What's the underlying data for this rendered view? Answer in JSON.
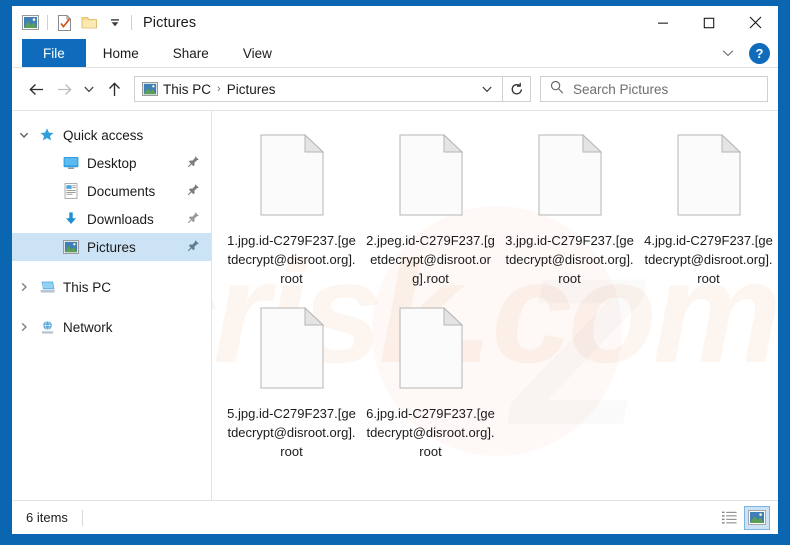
{
  "window": {
    "title": "Pictures",
    "quick_access_icons": [
      "picture-icon",
      "properties-checkmark-icon",
      "new-folder-icon",
      "customize-dropdown-icon"
    ],
    "controls": {
      "minimize": "─",
      "maximize": "□",
      "close": "✕"
    },
    "frame_color": "#0A66B0"
  },
  "ribbon": {
    "tabs": [
      {
        "label": "File",
        "active": true
      },
      {
        "label": "Home",
        "active": false
      },
      {
        "label": "Share",
        "active": false
      },
      {
        "label": "View",
        "active": false
      }
    ],
    "collapse_icon": "chevron-down-icon",
    "help_label": "?"
  },
  "navbar": {
    "back_icon": "arrow-left-icon",
    "forward_icon": "arrow-right-icon",
    "recent_icon": "chevron-down-icon",
    "up_icon": "arrow-up-icon",
    "breadcrumb": {
      "icon": "pictures-folder-icon",
      "parts": [
        "This PC",
        "Pictures"
      ],
      "separator": "›"
    },
    "dropdown_icon": "chevron-down-icon",
    "refresh_icon": "refresh-icon",
    "search": {
      "icon": "search-icon",
      "placeholder": "Search Pictures",
      "value": ""
    }
  },
  "sidebar": {
    "items": [
      {
        "label": "Quick access",
        "icon": "star-pin-icon",
        "twisty": "expanded",
        "indent": 0,
        "selected": false,
        "pinned": false
      },
      {
        "label": "Desktop",
        "icon": "desktop-icon",
        "twisty": "none",
        "indent": 1,
        "selected": false,
        "pinned": true
      },
      {
        "label": "Documents",
        "icon": "documents-icon",
        "twisty": "none",
        "indent": 1,
        "selected": false,
        "pinned": true
      },
      {
        "label": "Downloads",
        "icon": "downloads-icon",
        "twisty": "none",
        "indent": 1,
        "selected": false,
        "pinned": true
      },
      {
        "label": "Pictures",
        "icon": "pictures-icon",
        "twisty": "none",
        "indent": 1,
        "selected": true,
        "pinned": true
      },
      {
        "label": "This PC",
        "icon": "this-pc-icon",
        "twisty": "collapsed",
        "indent": 0,
        "selected": false,
        "pinned": false
      },
      {
        "label": "Network",
        "icon": "network-icon",
        "twisty": "collapsed",
        "indent": 0,
        "selected": false,
        "pinned": false
      }
    ]
  },
  "content": {
    "watermark_text": "pcrisk.com",
    "files": [
      {
        "name": "1.jpg.id-C279F237.[getdecrypt@disroot.org].root",
        "icon": "blank-document-icon"
      },
      {
        "name": "2.jpeg.id-C279F237.[getdecrypt@disroot.org].root",
        "icon": "blank-document-icon"
      },
      {
        "name": "3.jpg.id-C279F237.[getdecrypt@disroot.org].root",
        "icon": "blank-document-icon"
      },
      {
        "name": "4.jpg.id-C279F237.[getdecrypt@disroot.org].root",
        "icon": "blank-document-icon"
      },
      {
        "name": "5.jpg.id-C279F237.[getdecrypt@disroot.org].root",
        "icon": "blank-document-icon"
      },
      {
        "name": "6.jpg.id-C279F237.[getdecrypt@disroot.org].root",
        "icon": "blank-document-icon"
      }
    ]
  },
  "statusbar": {
    "item_count_text": "6 items",
    "views": [
      {
        "name": "details-view",
        "active": false
      },
      {
        "name": "large-icons-view",
        "active": true
      }
    ]
  }
}
